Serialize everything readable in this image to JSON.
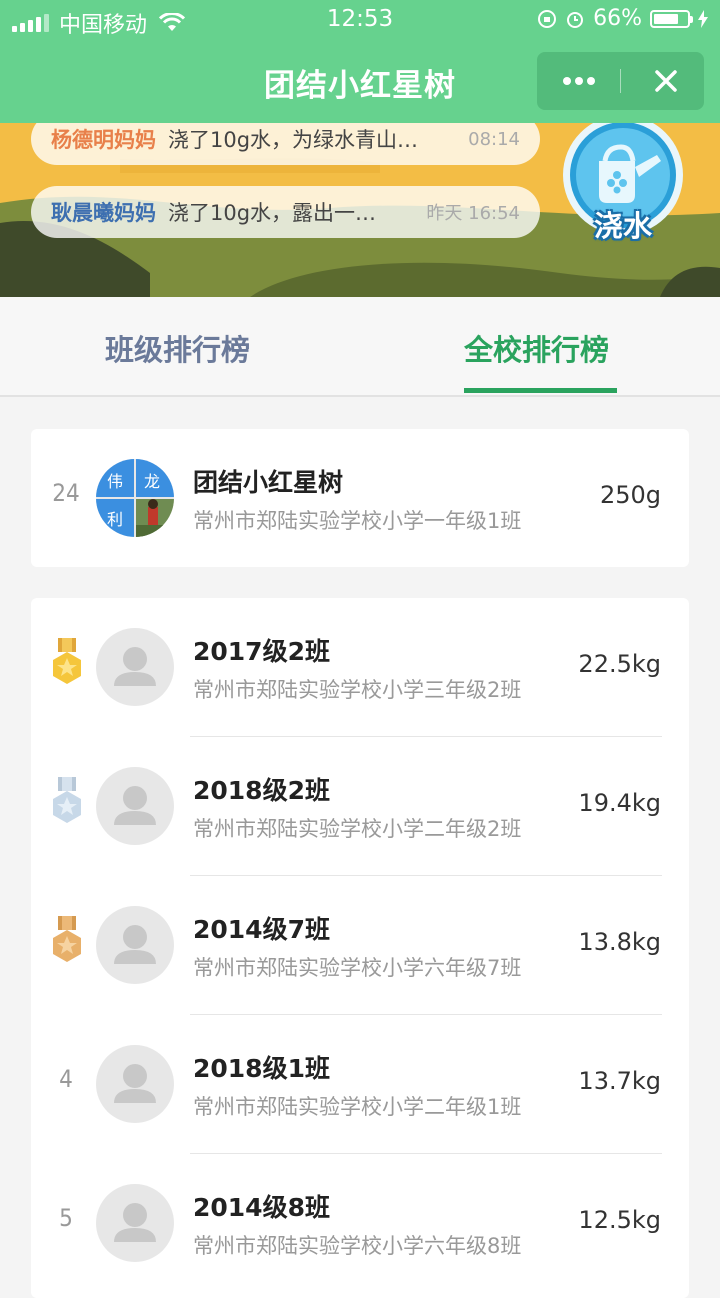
{
  "status_bar": {
    "carrier": "中国移动",
    "time": "12:53",
    "battery": "66%"
  },
  "nav": {
    "title": "团结小红星树"
  },
  "banner": {
    "messages": [
      {
        "name": "杨德明妈妈",
        "text": "浇了10g水，为绿水青山…",
        "time": "08:14",
        "name_color": "#e8804a"
      },
      {
        "name": "耿晨曦妈妈",
        "text": "浇了10g水，露出一…",
        "time": "昨天 16:54",
        "name_color": "#3d6fb0"
      }
    ],
    "water_button_label": "浇水"
  },
  "tabs": [
    {
      "label": "班级排行榜",
      "active": false
    },
    {
      "label": "全校排行榜",
      "active": true
    }
  ],
  "own_entry": {
    "rank": "24",
    "avatar_chars": [
      "伟",
      "龙",
      "利"
    ],
    "title": "团结小红星树",
    "subtitle": "常州市郑陆实验学校小学一年级1班",
    "value": "250g"
  },
  "ranking": [
    {
      "rank": "1",
      "medal": "gold",
      "title": "2017级2班",
      "subtitle": "常州市郑陆实验学校小学三年级2班",
      "value": "22.5kg"
    },
    {
      "rank": "2",
      "medal": "silver",
      "title": "2018级2班",
      "subtitle": "常州市郑陆实验学校小学二年级2班",
      "value": "19.4kg"
    },
    {
      "rank": "3",
      "medal": "bronze",
      "title": "2014级7班",
      "subtitle": "常州市郑陆实验学校小学六年级7班",
      "value": "13.8kg"
    },
    {
      "rank": "4",
      "medal": "",
      "title": "2018级1班",
      "subtitle": "常州市郑陆实验学校小学二年级1班",
      "value": "13.7kg"
    },
    {
      "rank": "5",
      "medal": "",
      "title": "2014级8班",
      "subtitle": "常州市郑陆实验学校小学六年级8班",
      "value": "12.5kg"
    }
  ],
  "colors": {
    "header_green": "#66d28e",
    "active_tab": "#2aa35e",
    "inactive_tab": "#6b7a9a",
    "banner_yellow": "#f3bd45"
  }
}
